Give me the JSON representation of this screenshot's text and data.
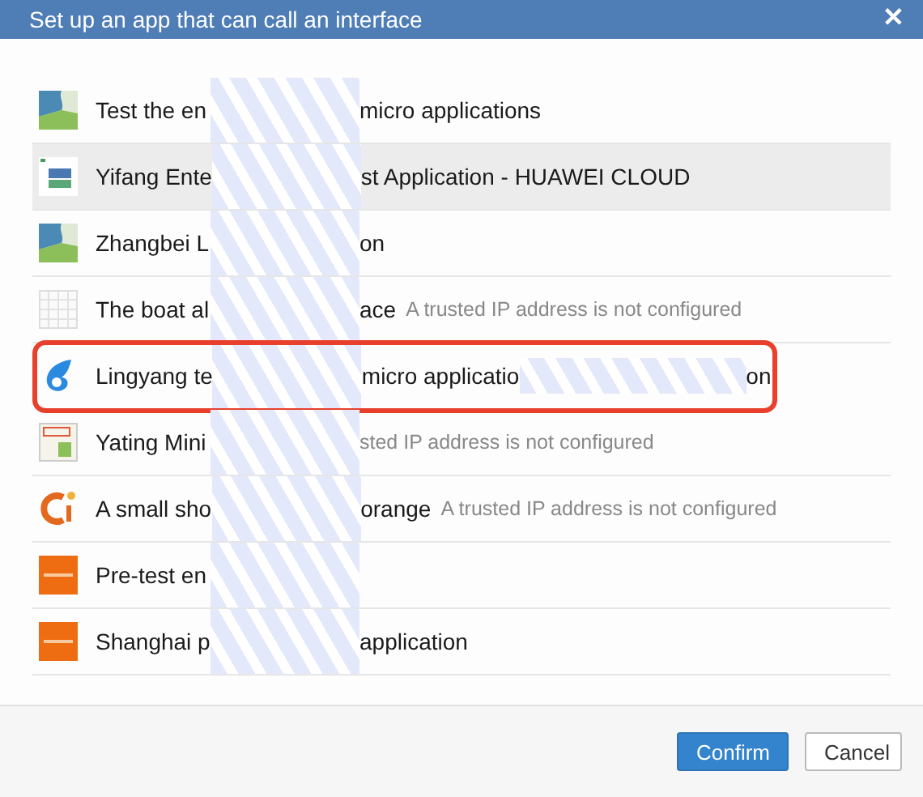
{
  "dialog": {
    "title": "Set up an app that can call an interface",
    "close": "✕"
  },
  "apps": [
    {
      "hovered": false,
      "marked": false,
      "segments": [
        {
          "kind": "name",
          "text": "Test the en"
        },
        {
          "kind": "redacted"
        },
        {
          "kind": "name",
          "text": "micro applications"
        }
      ]
    },
    {
      "hovered": true,
      "marked": false,
      "segments": [
        {
          "kind": "name",
          "text": "Yifang Ente"
        },
        {
          "kind": "redacted"
        },
        {
          "kind": "name",
          "text": "st Application - HUAWEI CLOUD"
        }
      ]
    },
    {
      "hovered": false,
      "marked": false,
      "segments": [
        {
          "kind": "name",
          "text": "Zhangbei L"
        },
        {
          "kind": "redacted"
        },
        {
          "kind": "name",
          "text": "on"
        }
      ]
    },
    {
      "hovered": false,
      "marked": false,
      "segments": [
        {
          "kind": "name",
          "text": "The boat al"
        },
        {
          "kind": "redacted"
        },
        {
          "kind": "name",
          "text": "ace"
        },
        {
          "kind": "note",
          "text": "A trusted IP address is not configured"
        }
      ]
    },
    {
      "hovered": false,
      "marked": true,
      "segments": [
        {
          "kind": "name",
          "text": "Lingyang te"
        },
        {
          "kind": "redacted"
        },
        {
          "kind": "name",
          "text": "micro applicatio"
        },
        {
          "kind": "redacted"
        },
        {
          "kind": "name",
          "text": "on"
        }
      ]
    },
    {
      "hovered": false,
      "marked": false,
      "segments": [
        {
          "kind": "name",
          "text": "Yating Mini"
        },
        {
          "kind": "redacted"
        },
        {
          "kind": "note",
          "text": "sted IP address is not configured"
        }
      ]
    },
    {
      "hovered": false,
      "marked": false,
      "segments": [
        {
          "kind": "name",
          "text": "A small sho"
        },
        {
          "kind": "redacted"
        },
        {
          "kind": "name",
          "text": "orange"
        },
        {
          "kind": "note",
          "text": "A trusted IP address is not configured"
        }
      ]
    },
    {
      "hovered": false,
      "marked": false,
      "segments": [
        {
          "kind": "name",
          "text": "Pre-test en"
        },
        {
          "kind": "redacted"
        }
      ]
    },
    {
      "hovered": false,
      "marked": false,
      "segments": [
        {
          "kind": "name",
          "text": "Shanghai p"
        },
        {
          "kind": "redacted"
        },
        {
          "kind": "name",
          "text": "application"
        }
      ]
    }
  ],
  "buttons": [
    {
      "kind": "primary",
      "label": "Confirm"
    },
    {
      "kind": "secondary",
      "label": "Cancel"
    }
  ]
}
